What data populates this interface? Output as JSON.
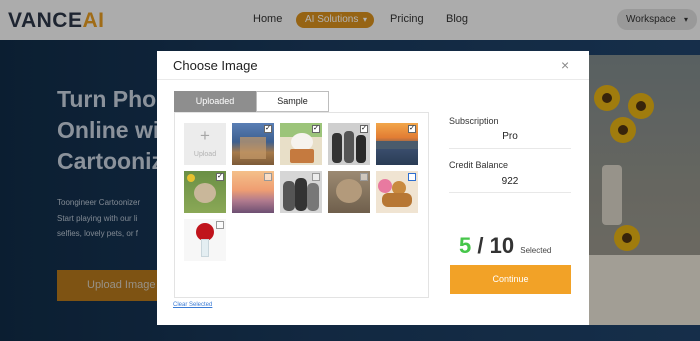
{
  "nav": {
    "logo_main": "VANCE",
    "logo_ai": "AI",
    "links": {
      "home": "Home",
      "ai_solutions": "AI Solutions",
      "pricing": "Pricing",
      "blog": "Blog"
    },
    "workspace": "Workspace"
  },
  "hero": {
    "title_lines": [
      "Turn Pho",
      "Online wi",
      "Cartooniz"
    ],
    "body_lines": [
      "Toongineer Cartoonizer",
      "Start playing with our li",
      "selfies, lovely pets, or f"
    ],
    "upload_button": "Upload Image"
  },
  "modal": {
    "title": "Choose Image",
    "close": "×",
    "tabs": [
      "Uploaded",
      "Sample"
    ],
    "upload_tile": {
      "plus": "+",
      "label": "Upload"
    },
    "thumbnails": [
      {
        "subject": "town-street-photo",
        "selected": true
      },
      {
        "subject": "white-cat-photo",
        "selected": true
      },
      {
        "subject": "family-bw-photo",
        "selected": true
      },
      {
        "subject": "lake-sunset-photo",
        "selected": true
      },
      {
        "subject": "hedgehog-photo",
        "selected": true
      },
      {
        "subject": "mountain-sunset-photo",
        "selected": false
      },
      {
        "subject": "family-portrait-photo",
        "selected": false
      },
      {
        "subject": "tabby-cat-photo",
        "selected": false
      },
      {
        "subject": "donuts-photo",
        "selected": false
      },
      {
        "subject": "roses-photo",
        "selected": false
      }
    ],
    "clear_selected": "Clear Selected",
    "subscription": {
      "label": "Subscription",
      "value": "Pro"
    },
    "credit_balance": {
      "label": "Credit Balance",
      "value": "922"
    },
    "selected_count": "5",
    "separator": "/",
    "max_count": "10",
    "selected_label": "Selected",
    "continue_button": "Continue"
  }
}
